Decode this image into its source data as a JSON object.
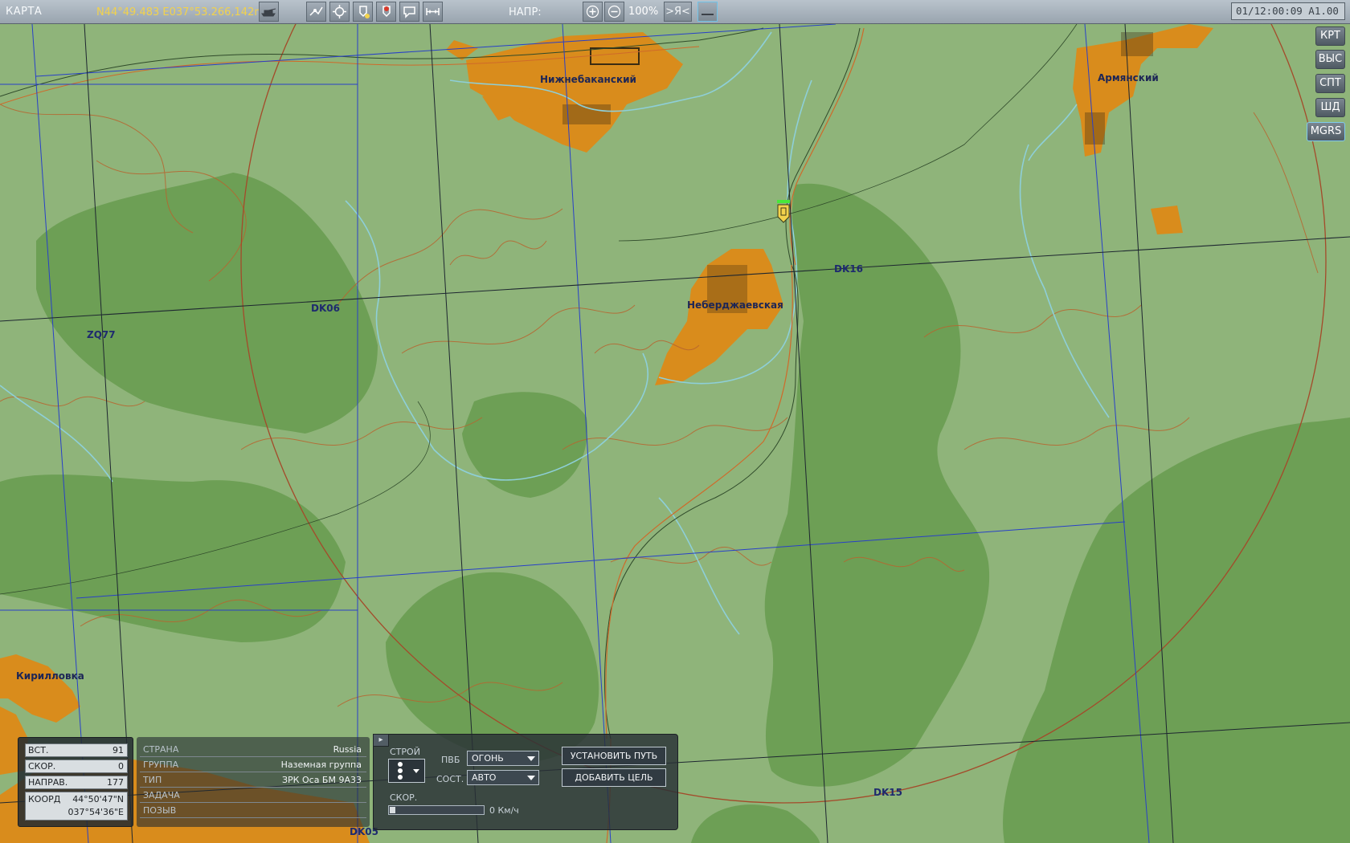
{
  "toolbar": {
    "title": "КАРТА",
    "coords": "N44°49.483 E037°53.266,142m",
    "heading_label": "НАПР:",
    "zoom_value": "100%",
    "center_on_me": ">Я<",
    "mission_time": "01/12:00:09 A1.00"
  },
  "side_buttons": [
    "КРТ",
    "ВЫС",
    "СПТ",
    "ШД",
    "MGRS"
  ],
  "map": {
    "towns": [
      {
        "name": "Нижнебаканский"
      },
      {
        "name": "Армянский"
      },
      {
        "name": "Неберджаевская"
      },
      {
        "name": "Кирилловка"
      }
    ],
    "grid_labels": [
      "DK06",
      "ZQ77",
      "DK16",
      "DK15",
      "DK05"
    ]
  },
  "unit_stats": {
    "alt_label": "ВСТ.",
    "alt_value": "91",
    "speed_label": "СКОР.",
    "speed_value": "0",
    "heading_label": "НАПРАВ.",
    "heading_value": "177",
    "coord_label": "КООРД",
    "coord_lat": "44°50'47\"N",
    "coord_lon": "037°54'36\"E"
  },
  "unit_info": [
    {
      "key": "СТРАНА",
      "value": "Russia"
    },
    {
      "key": "ГРУППА",
      "value": "Наземная группа"
    },
    {
      "key": "ТИП",
      "value": "ЗРК Оса БМ 9А33"
    },
    {
      "key": "ЗАДАЧА",
      "value": ""
    },
    {
      "key": "ПОЗЫВ",
      "value": ""
    }
  ],
  "orders": {
    "formation_label": "СТРОЙ",
    "roe_label": "ПВБ",
    "roe_value": "ОГОНЬ",
    "state_label": "СОСТ.",
    "state_value": "АВТО",
    "speed_label": "СКОР.",
    "speed_value": "0 Км/ч",
    "speed_fraction": 0.06,
    "set_route_button": "УСТАНОВИТЬ ПУТЬ",
    "add_target_button": "ДОБАВИТЬ ЦЕЛЬ"
  }
}
